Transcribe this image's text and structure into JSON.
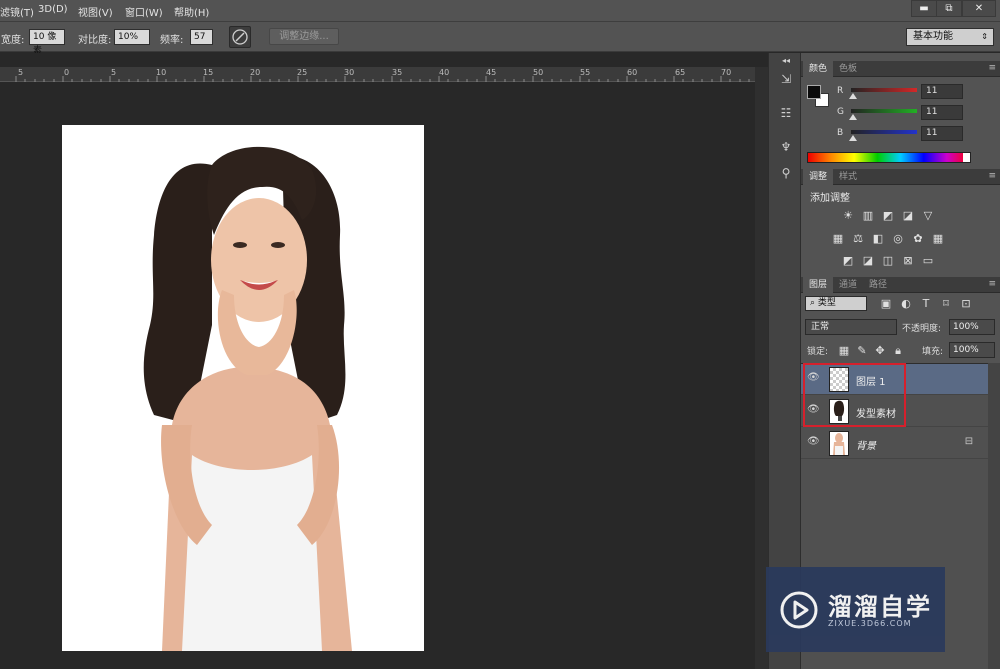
{
  "menubar": {
    "items": [
      "滤镜(T)",
      "3D(D)",
      "视图(V)",
      "窗口(W)",
      "帮助(H)"
    ],
    "window_controls": {
      "minimize": "▬",
      "restore": "⧉",
      "close": "✕"
    }
  },
  "options": {
    "width_label": "宽度:",
    "width_value": "10 像素",
    "contrast_label": "对比度:",
    "contrast_value": "10%",
    "frequency_label": "频率:",
    "frequency_value": "57",
    "refine_edge_label": "调整边缘...",
    "workspace": "基本功能"
  },
  "ruler": {
    "labels": [
      "5",
      "0",
      "5",
      "10",
      "15",
      "20",
      "25",
      "30",
      "35",
      "40",
      "45",
      "50",
      "55",
      "60",
      "65",
      "70"
    ]
  },
  "color_panel": {
    "tabs": [
      "颜色",
      "色板"
    ],
    "channels": [
      {
        "name": "R",
        "value": "11",
        "color": "#d42828"
      },
      {
        "name": "G",
        "value": "11",
        "color": "#22b024"
      },
      {
        "name": "B",
        "value": "11",
        "color": "#2233cc"
      }
    ]
  },
  "adjustments_panel": {
    "tabs": [
      "调整",
      "样式"
    ],
    "add_adjustment": "添加调整"
  },
  "layers_panel": {
    "tabs": [
      "图层",
      "通道",
      "路径"
    ],
    "filter_kind": "类型",
    "blend_mode": "正常",
    "opacity_label": "不透明度:",
    "opacity_value": "100%",
    "lock_label": "锁定:",
    "fill_label": "填充:",
    "fill_value": "100%",
    "layers": [
      {
        "name": "图层 1",
        "selected": true
      },
      {
        "name": "发型素材",
        "selected": false
      },
      {
        "name": "背景",
        "selected": false,
        "locked": true
      }
    ]
  },
  "watermark": {
    "title": "溜溜自学",
    "url": "ZIXUE.3D66.COM"
  },
  "colors": {
    "highlight_box": "#d6202c",
    "selected_layer": "#5a6a85"
  }
}
